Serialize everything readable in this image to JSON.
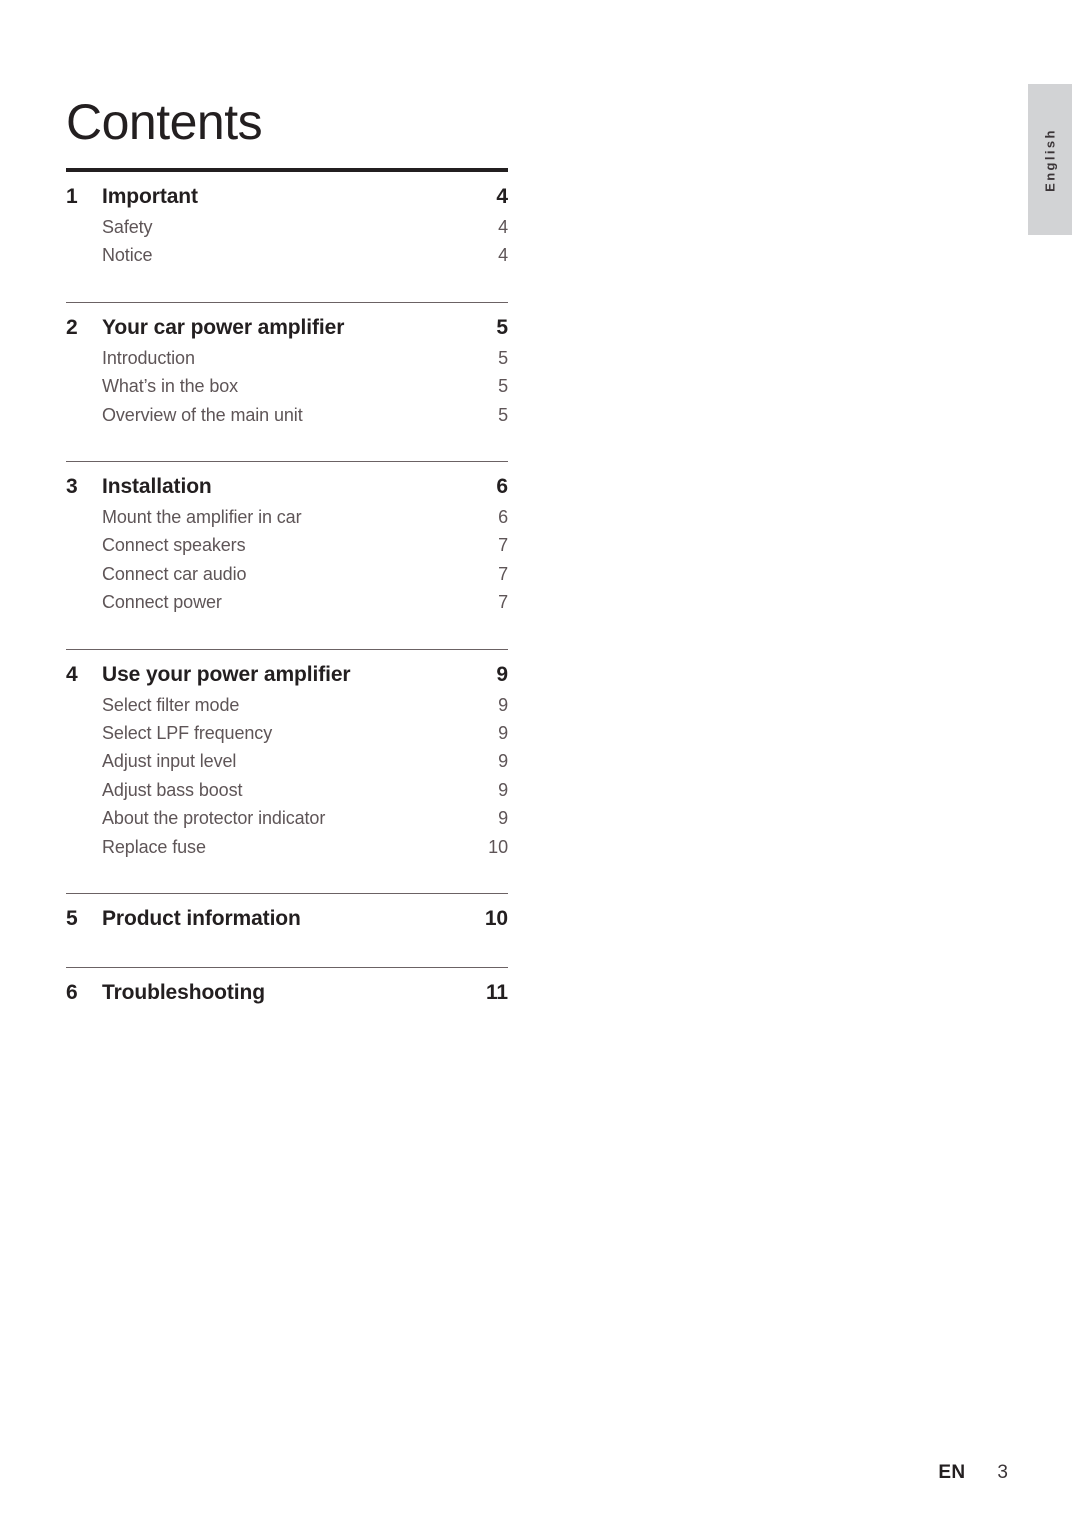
{
  "page": {
    "title": "Contents",
    "language_tab": "English"
  },
  "toc": {
    "sections": [
      {
        "number": "1",
        "title": "Important",
        "page": "4",
        "rule_style": "thick",
        "entries": [
          {
            "label": "Safety",
            "page": "4"
          },
          {
            "label": "Notice",
            "page": "4"
          }
        ]
      },
      {
        "number": "2",
        "title": "Your car power amplifier",
        "page": "5",
        "rule_style": "thin",
        "entries": [
          {
            "label": "Introduction",
            "page": "5"
          },
          {
            "label": "What’s in the box",
            "page": "5"
          },
          {
            "label": "Overview of the main unit",
            "page": "5"
          }
        ]
      },
      {
        "number": "3",
        "title": "Installation",
        "page": "6",
        "rule_style": "thin",
        "entries": [
          {
            "label": "Mount the amplifier in car",
            "page": "6"
          },
          {
            "label": "Connect speakers",
            "page": "7"
          },
          {
            "label": "Connect car audio",
            "page": "7"
          },
          {
            "label": "Connect power",
            "page": "7"
          }
        ]
      },
      {
        "number": "4",
        "title": "Use your power amplifier",
        "page": "9",
        "rule_style": "thin",
        "entries": [
          {
            "label": "Select filter mode",
            "page": "9"
          },
          {
            "label": "Select LPF frequency",
            "page": "9"
          },
          {
            "label": "Adjust input level",
            "page": "9"
          },
          {
            "label": "Adjust bass boost",
            "page": "9"
          },
          {
            "label": "About the protector indicator",
            "page": "9"
          },
          {
            "label": "Replace fuse",
            "page": "10"
          }
        ]
      },
      {
        "number": "5",
        "title": "Product information",
        "page": "10",
        "rule_style": "thin",
        "entries": []
      },
      {
        "number": "6",
        "title": "Troubleshooting",
        "page": "11",
        "rule_style": "thin",
        "entries": []
      }
    ]
  },
  "footer": {
    "language_code": "EN",
    "page_number": "3"
  }
}
